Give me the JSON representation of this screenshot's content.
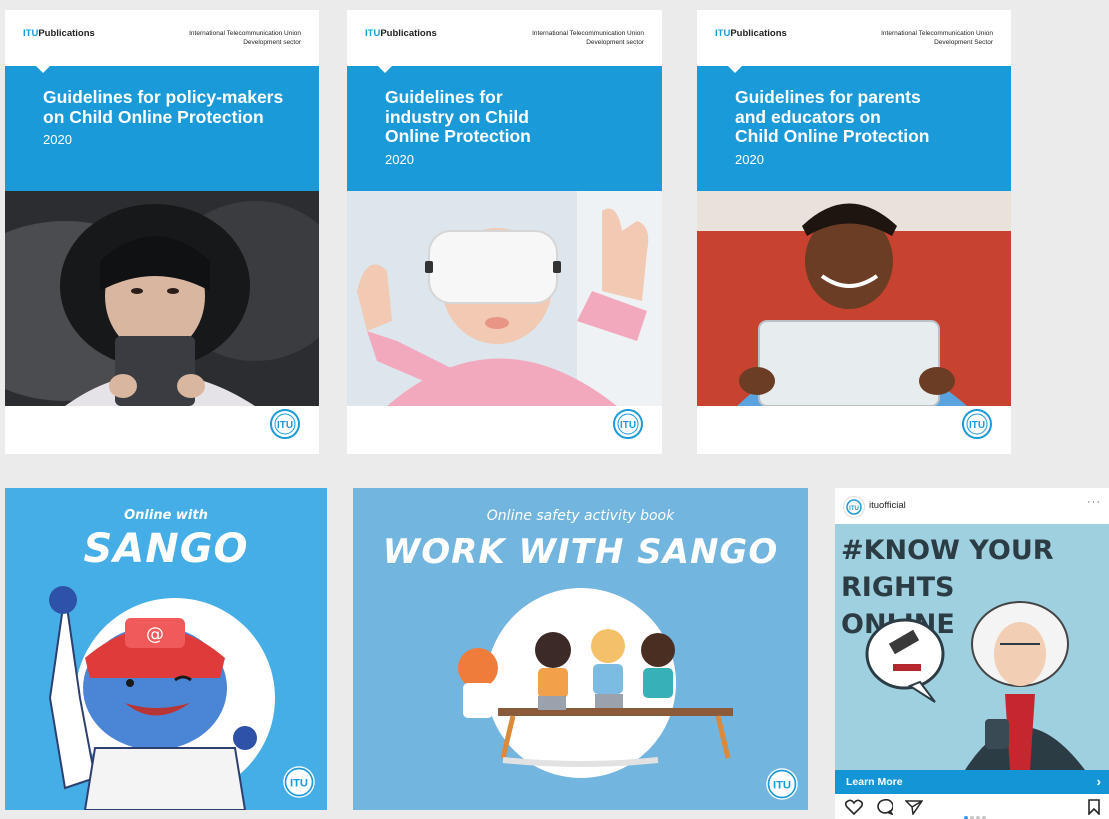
{
  "covers": [
    {
      "publisher_prefix": "ITU",
      "publisher_suffix": "Publications",
      "org_line1": "International Telecommunication Union",
      "org_line2": "Development sector",
      "title": "Guidelines for policy-makers\non Child Online Protection",
      "year": "2020",
      "badge": "ITU"
    },
    {
      "publisher_prefix": "ITU",
      "publisher_suffix": "Publications",
      "org_line1": "International Telecommunication Union",
      "org_line2": "Development sector",
      "title": "Guidelines for\nindustry on Child\nOnline Protection",
      "year": "2020",
      "badge": "ITU"
    },
    {
      "publisher_prefix": "ITU",
      "publisher_suffix": "Publications",
      "org_line1": "International Telecommunication Union",
      "org_line2": "Development Sector",
      "title": "Guidelines for parents\nand educators on\nChild Online Protection",
      "year": "2020",
      "badge": "ITU"
    }
  ],
  "sango_tile": {
    "small": "Online with",
    "big": "SANGO",
    "badge": "ITU",
    "bg": "#45aee6"
  },
  "workbook_tile": {
    "small": "Online safety activity book",
    "big": "WORK WITH SANGO",
    "badge": "ITU",
    "bg": "#72b5de"
  },
  "instagram": {
    "username": "ituofficial",
    "more": "···",
    "headline": "#KNOW YOUR RIGHTS\nONLINE",
    "cta": "Learn More",
    "cta_arrow": "›",
    "carousel_active": 1,
    "carousel_count": 4
  },
  "colors": {
    "itu_blue": "#1a9ad9",
    "page_bg": "#ebebeb"
  },
  "icons": [
    "heart-icon",
    "comment-icon",
    "share-icon",
    "bookmark-icon",
    "itu-logo-icon"
  ]
}
